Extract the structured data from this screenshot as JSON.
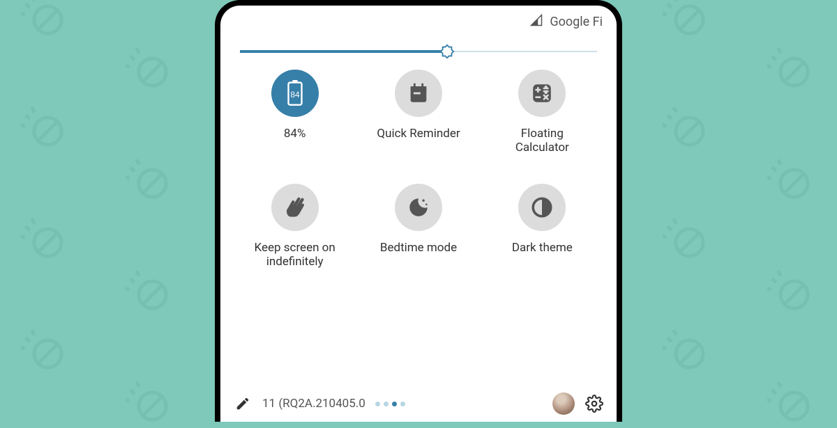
{
  "status": {
    "carrier": "Google Fi"
  },
  "brightness": {
    "percent": 58
  },
  "tiles": [
    {
      "id": "battery",
      "label": "84%",
      "battery_value": "84",
      "active": true
    },
    {
      "id": "quick-reminder",
      "label": "Quick Reminder",
      "active": false
    },
    {
      "id": "floating-calculator",
      "label": "Floating\nCalculator",
      "active": false
    },
    {
      "id": "keep-screen",
      "label": "Keep screen on\nindefinitely",
      "active": false
    },
    {
      "id": "bedtime",
      "label": "Bedtime mode",
      "active": false
    },
    {
      "id": "dark-theme",
      "label": "Dark theme",
      "active": false
    }
  ],
  "footer": {
    "build": "11 (RQ2A.210405.0",
    "page_index": 2,
    "page_count": 4
  }
}
